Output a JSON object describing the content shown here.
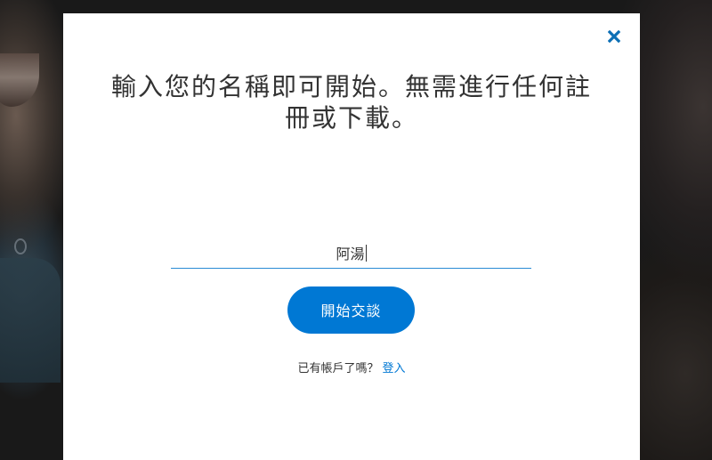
{
  "dialog": {
    "heading": "輸入您的名稱即可開始。無需進行任何註冊或下載。",
    "close_icon": "close-icon",
    "name_input": {
      "value": "阿湯",
      "focused": true
    },
    "start_button_label": "開始交談",
    "account_prompt": "已有帳戶了嗎？",
    "signin_link_label": "登入"
  },
  "colors": {
    "accent": "#0078d4",
    "close_icon": "#0c6fb5",
    "text": "#333333",
    "modal_background": "#ffffff"
  }
}
